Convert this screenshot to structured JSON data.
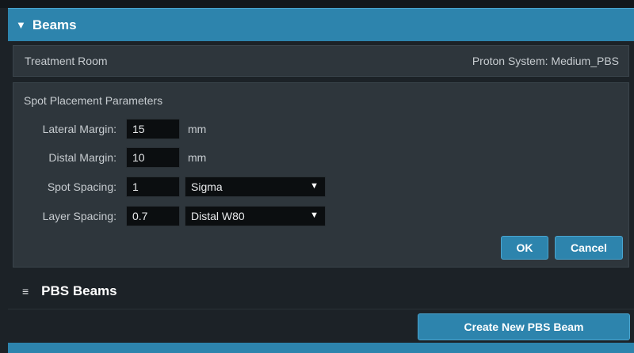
{
  "header": {
    "collapse_icon": "triangle-down-icon",
    "title": "Beams"
  },
  "treatment": {
    "room_label": "Treatment Room",
    "system_label": "Proton System: Medium_PBS"
  },
  "spot_params": {
    "title": "Spot Placement Parameters",
    "lateral_margin": {
      "label": "Lateral Margin:",
      "value": "15",
      "unit": "mm"
    },
    "distal_margin": {
      "label": "Distal Margin:",
      "value": "10",
      "unit": "mm"
    },
    "spot_spacing": {
      "label": "Spot Spacing:",
      "value": "1",
      "mode": "Sigma"
    },
    "layer_spacing": {
      "label": "Layer Spacing:",
      "value": "0.7",
      "mode": "Distal W80"
    },
    "dropdown_arrow": "▼",
    "ok_label": "OK",
    "cancel_label": "Cancel"
  },
  "pbs": {
    "menu_icon": "≡",
    "title": "PBS Beams",
    "create_label": "Create New PBS Beam"
  },
  "colors": {
    "accent": "#2d84ad",
    "panel": "#2e363c",
    "background": "#1c2227",
    "field": "#0b0e10"
  }
}
